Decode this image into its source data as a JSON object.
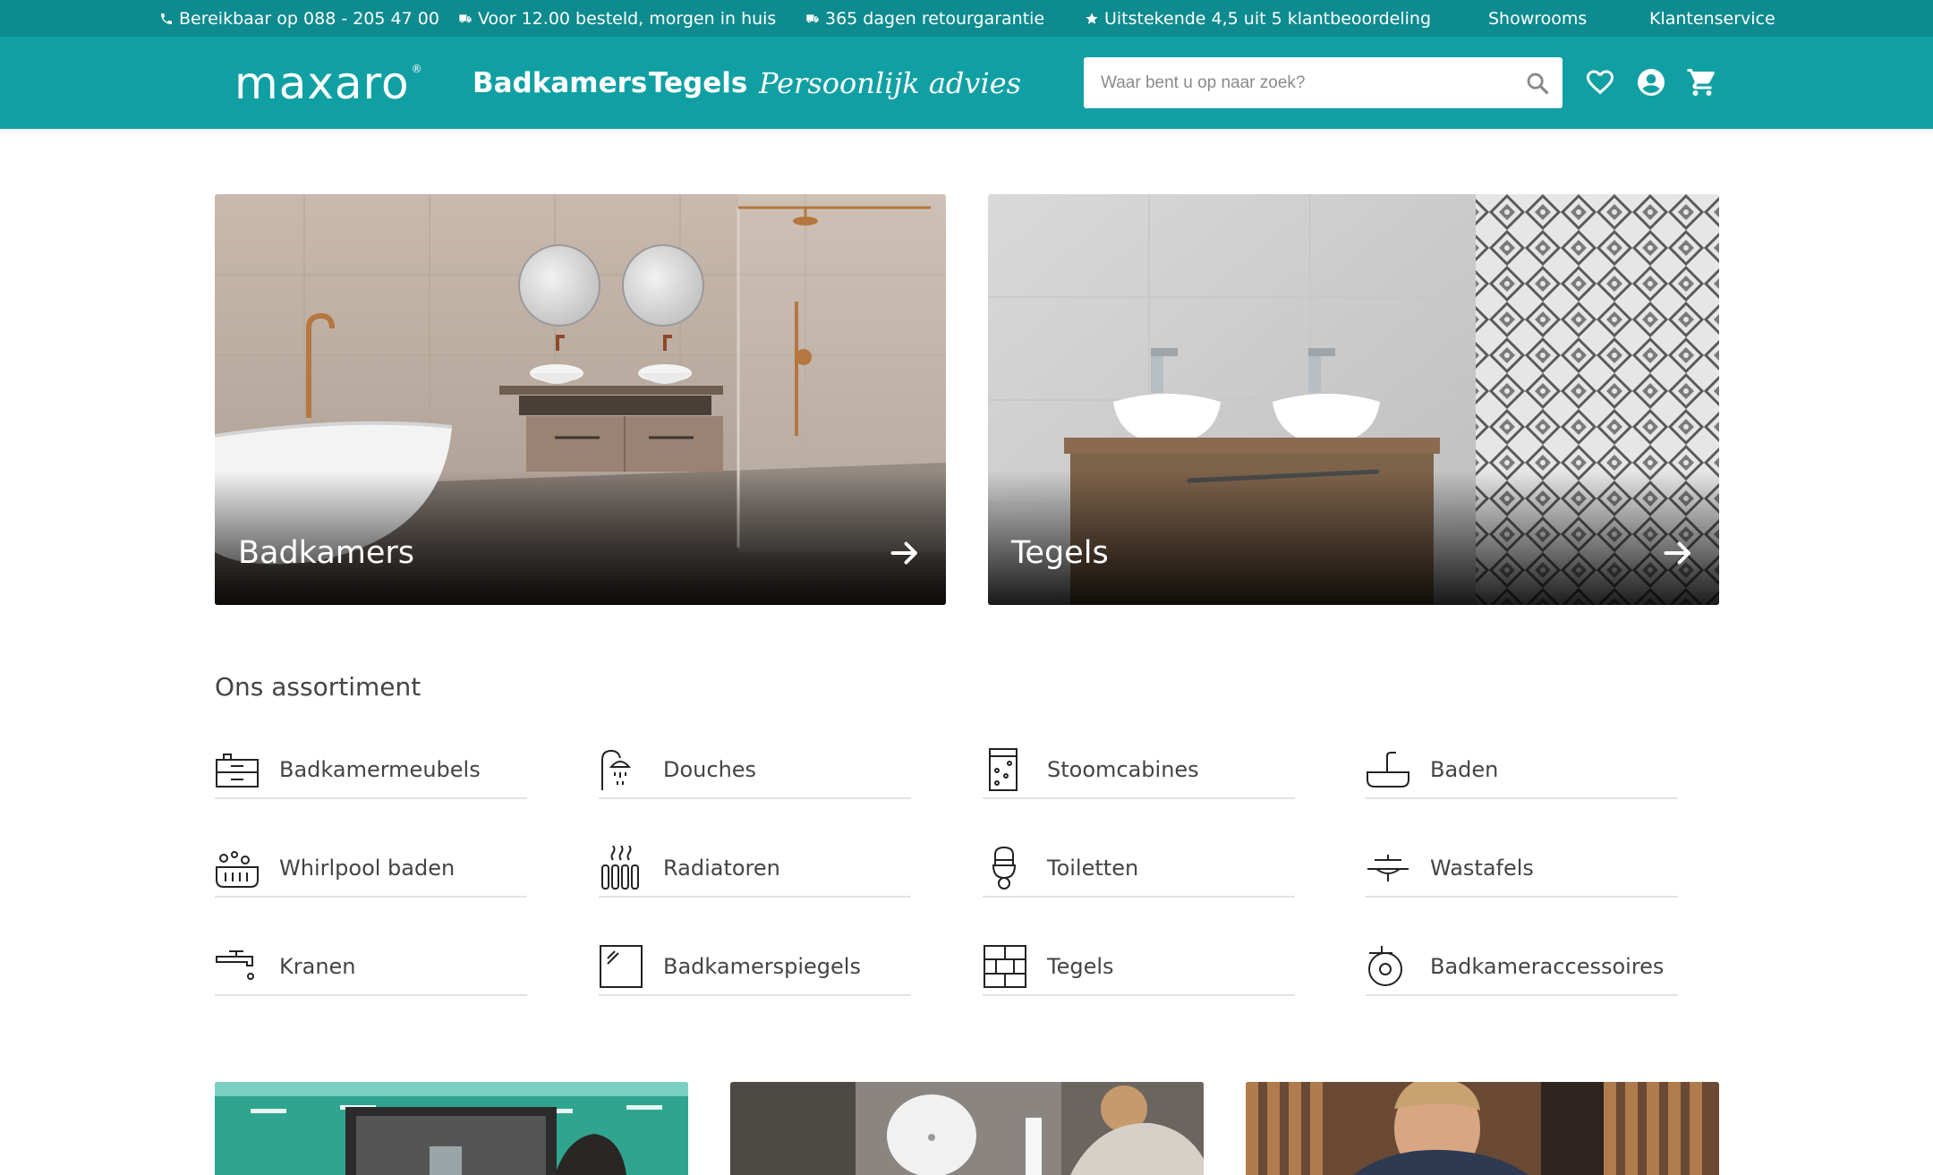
{
  "topbar": {
    "phone": "Bereikbaar op 088 - 205 47 00",
    "delivery": "Voor 12.00 besteld, morgen in huis",
    "returns": "365 dagen retourgarantie",
    "rating": "Uitstekende 4,5 uit 5 klantbeoordeling",
    "showrooms": "Showrooms",
    "service": "Klantenservice"
  },
  "header": {
    "logo": "maxaro",
    "nav": [
      "Badkamers",
      "Tegels",
      "Persoonlijk advies"
    ],
    "search_placeholder": "Waar bent u op naar zoek?"
  },
  "hero": [
    {
      "title": "Badkamers"
    },
    {
      "title": "Tegels"
    }
  ],
  "assortment": {
    "title": "Ons assortiment",
    "items": [
      "Badkamermeubels",
      "Douches",
      "Stoomcabines",
      "Baden",
      "Whirlpool baden",
      "Radiatoren",
      "Toiletten",
      "Wastafels",
      "Kranen",
      "Badkamerspiegels",
      "Tegels",
      "Badkameraccessoires"
    ]
  },
  "colors": {
    "topbar": "#0d8b8f",
    "header": "#10a0a4"
  }
}
